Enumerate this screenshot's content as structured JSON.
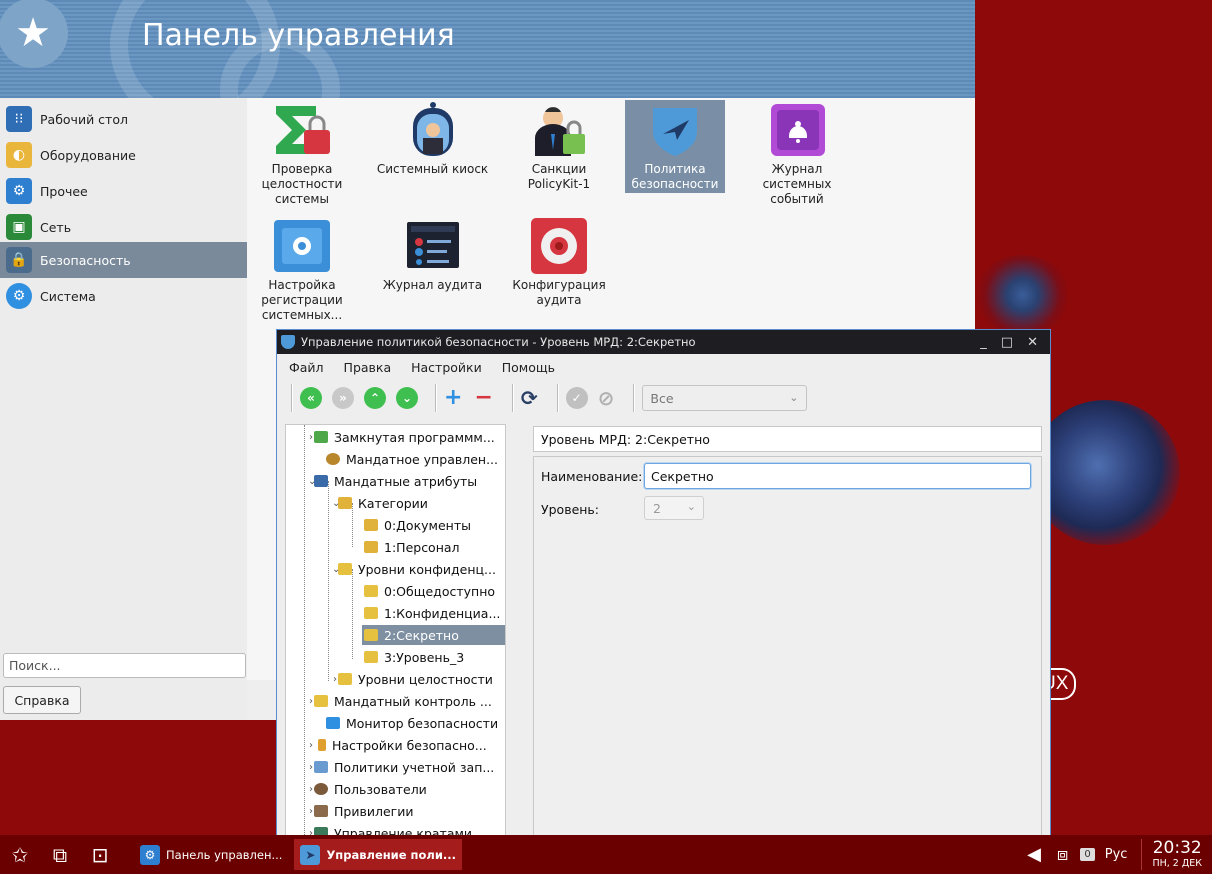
{
  "control_panel": {
    "title": "Панель управления",
    "sidebar": [
      {
        "label": "Рабочий стол",
        "icon": "desktop-icon",
        "color": "#2f6db5"
      },
      {
        "label": "Оборудование",
        "icon": "hardware-icon",
        "color": "#2f6db5"
      },
      {
        "label": "Прочее",
        "icon": "other-icon",
        "color": "#2f7fd0"
      },
      {
        "label": "Сеть",
        "icon": "network-icon",
        "color": "#2a8a3a"
      },
      {
        "label": "Безопасность",
        "icon": "security-icon",
        "color": "#3c5f85"
      },
      {
        "label": "Система",
        "icon": "system-icon",
        "color": "#2f8fe0"
      }
    ],
    "apps": [
      {
        "label": "Проверка целостности системы",
        "icon": "integrity-check-icon"
      },
      {
        "label": "Системный киоск",
        "icon": "kiosk-icon"
      },
      {
        "label": "Санкции PolicyKit-1",
        "icon": "policykit-icon"
      },
      {
        "label": "Политика безопасности",
        "icon": "security-policy-icon"
      },
      {
        "label": "Журнал системных событий",
        "icon": "event-log-icon"
      },
      {
        "label": "Настройка регистрации системных...",
        "icon": "registration-settings-icon"
      },
      {
        "label": "Журнал аудита",
        "icon": "audit-log-icon"
      },
      {
        "label": "Конфигурация аудита",
        "icon": "audit-config-icon"
      }
    ],
    "search_placeholder": "Поиск...",
    "help_label": "Справка"
  },
  "security_window": {
    "title": "Управление политикой безопасности - Уровень МРД: 2:Секретно",
    "menu": [
      "Файл",
      "Правка",
      "Настройки",
      "Помощь"
    ],
    "filter_value": "Все",
    "tree": [
      "Замкнутая программм...",
      "Мандатное управлен...",
      "Мандатные атрибуты",
      "Категории",
      "0:Документы",
      "1:Персонал",
      "Уровни конфиденц...",
      "0:Общедоступно",
      "1:Конфиденциа...",
      "2:Секретно",
      "3:Уровень_3",
      "Уровни целостности",
      "Мандатный контроль ...",
      "Монитор безопасности",
      "Настройки безопасно...",
      "Политики учетной зап...",
      "Пользователи",
      "Привилегии",
      "Управление кратами"
    ],
    "panel_header": "Уровень МРД: 2:Секретно",
    "name_label": "Наименование:",
    "name_value": "Секретно",
    "level_label": "Уровень:",
    "level_value": "2"
  },
  "desktop": {
    "brand_text": "UX"
  },
  "taskbar": {
    "tasks": [
      "Панель управлен...",
      "Управление поли..."
    ],
    "notification_count": "0",
    "keyboard_layout": "Рус",
    "time": "20:32",
    "date": "ПН, 2 ДЕК"
  }
}
